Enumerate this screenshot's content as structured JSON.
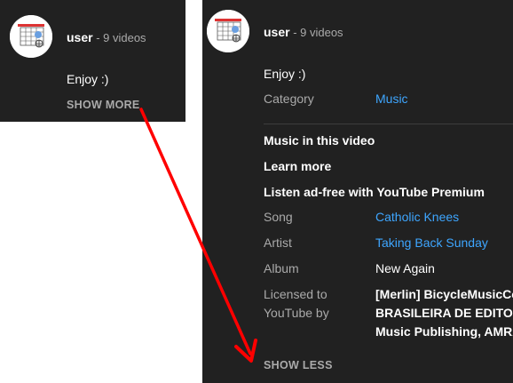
{
  "collapsed": {
    "channel": {
      "name": "user",
      "meta": " - 9 videos"
    },
    "description": "Enjoy :)",
    "toggle_label": "SHOW MORE"
  },
  "expanded": {
    "channel": {
      "name": "user",
      "meta": " - 9 videos"
    },
    "description": "Enjoy :)",
    "category": {
      "label": "Category",
      "value": "Music"
    },
    "music_section": {
      "heading": "Music in this video",
      "learn_more": "Learn more",
      "premium": "Listen ad-free with YouTube Premium"
    },
    "song": {
      "label": "Song",
      "value": "Catholic Knees"
    },
    "artist": {
      "label": "Artist",
      "value": "Taking Back Sunday"
    },
    "album": {
      "label": "Album",
      "value": "New Again"
    },
    "licensed": {
      "label_line1": "Licensed to",
      "label_line2": "YouTube by",
      "value_line1": "[Merlin] BicycleMusicCom",
      "value_line2": "BRASILEIRA DE EDITORA",
      "value_line3": "Music Publishing, AMRA,"
    },
    "toggle_label": "SHOW LESS"
  },
  "colors": {
    "panel_bg": "#212121",
    "link": "#3ea6ff",
    "secondary_text": "#aaaaaa",
    "arrow": "#ff0000"
  }
}
